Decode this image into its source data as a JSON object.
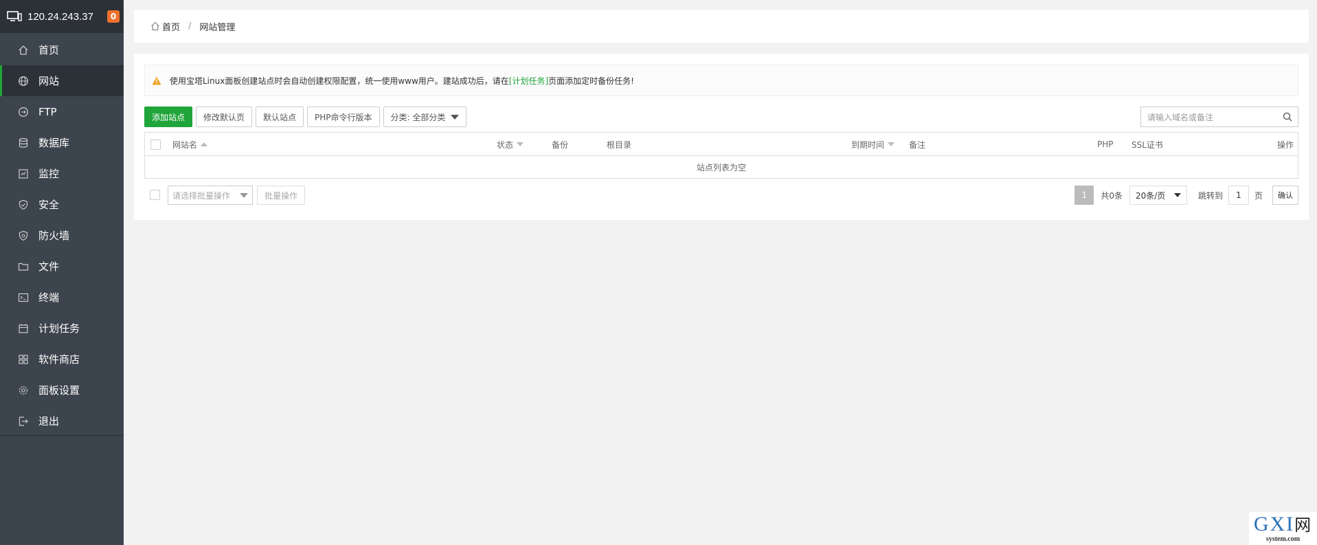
{
  "sidebar": {
    "ip": "120.24.243.37",
    "badge": "0",
    "items": [
      {
        "label": "首页",
        "icon": "home-icon"
      },
      {
        "label": "网站",
        "icon": "globe-icon"
      },
      {
        "label": "FTP",
        "icon": "ftp-icon"
      },
      {
        "label": "数据库",
        "icon": "database-icon"
      },
      {
        "label": "监控",
        "icon": "monitor-icon"
      },
      {
        "label": "安全",
        "icon": "shield-check-icon"
      },
      {
        "label": "防火墙",
        "icon": "firewall-icon"
      },
      {
        "label": "文件",
        "icon": "folder-icon"
      },
      {
        "label": "终端",
        "icon": "terminal-icon"
      },
      {
        "label": "计划任务",
        "icon": "calendar-icon"
      },
      {
        "label": "软件商店",
        "icon": "grid-icon"
      },
      {
        "label": "面板设置",
        "icon": "gear-icon"
      },
      {
        "label": "退出",
        "icon": "logout-icon"
      }
    ],
    "active_index": 1,
    "accent": "#20a53a"
  },
  "breadcrumb": {
    "home": "首页",
    "separator": "/",
    "current": "网站管理"
  },
  "notice": {
    "text_before": "使用宝塔Linux面板创建站点时会自动创建权限配置，统一使用www用户。建站成功后，请在",
    "link": "[计划任务]",
    "text_after": "页面添加定时备份任务!"
  },
  "toolbar": {
    "add_site": "添加站点",
    "modify_default_page": "修改默认页",
    "default_site": "默认站点",
    "php_cli_version": "PHP命令行版本",
    "category": "分类: 全部分类",
    "search_placeholder": "请输入域名或备注"
  },
  "table": {
    "columns": {
      "name": "网站名",
      "status": "状态",
      "backup": "备份",
      "root": "根目录",
      "expire": "到期时间",
      "remark": "备注",
      "php": "PHP",
      "ssl": "SSL证书",
      "actions": "操作"
    },
    "empty_text": "站点列表为空"
  },
  "footer": {
    "batch_placeholder": "请选择批量操作",
    "batch_button": "批量操作",
    "pager": {
      "current": "1",
      "total": "共0条",
      "page_size": "20条/页",
      "jump_label": "跳转到",
      "jump_value": "1",
      "page_unit": "页",
      "confirm": "确认"
    }
  },
  "watermark": {
    "main": "GXI",
    "net": "网",
    "sub": "system.com"
  }
}
